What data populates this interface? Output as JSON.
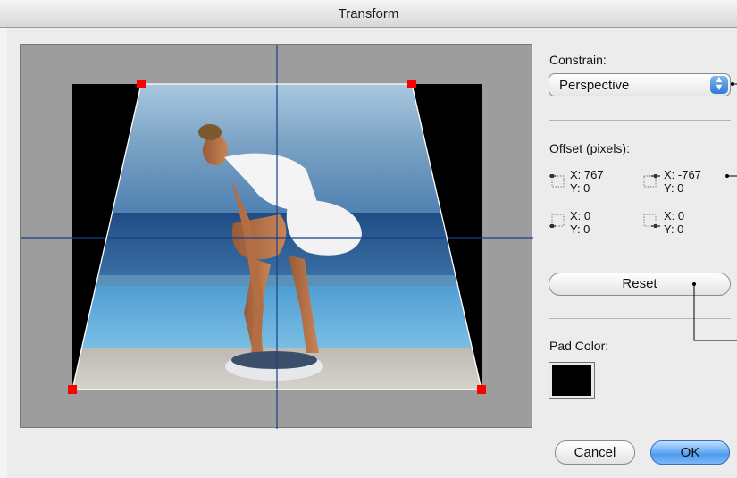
{
  "window": {
    "title": "Transform"
  },
  "constrain": {
    "label": "Constrain:",
    "value": "Perspective"
  },
  "offset": {
    "label": "Offset (pixels):",
    "corners": [
      {
        "x": "X: 767",
        "y": "Y: 0"
      },
      {
        "x": "X: -767",
        "y": "Y: 0"
      },
      {
        "x": "X: 0",
        "y": "Y: 0"
      },
      {
        "x": "X: 0",
        "y": "Y: 0"
      }
    ]
  },
  "buttons": {
    "reset": "Reset",
    "cancel": "Cancel",
    "ok": "OK"
  },
  "pad_color": {
    "label": "Pad Color:",
    "value": "#000000"
  },
  "colors": {
    "handle": "#ff0000",
    "guide": "#1c3f86",
    "canvas": "#9d9d9d"
  }
}
